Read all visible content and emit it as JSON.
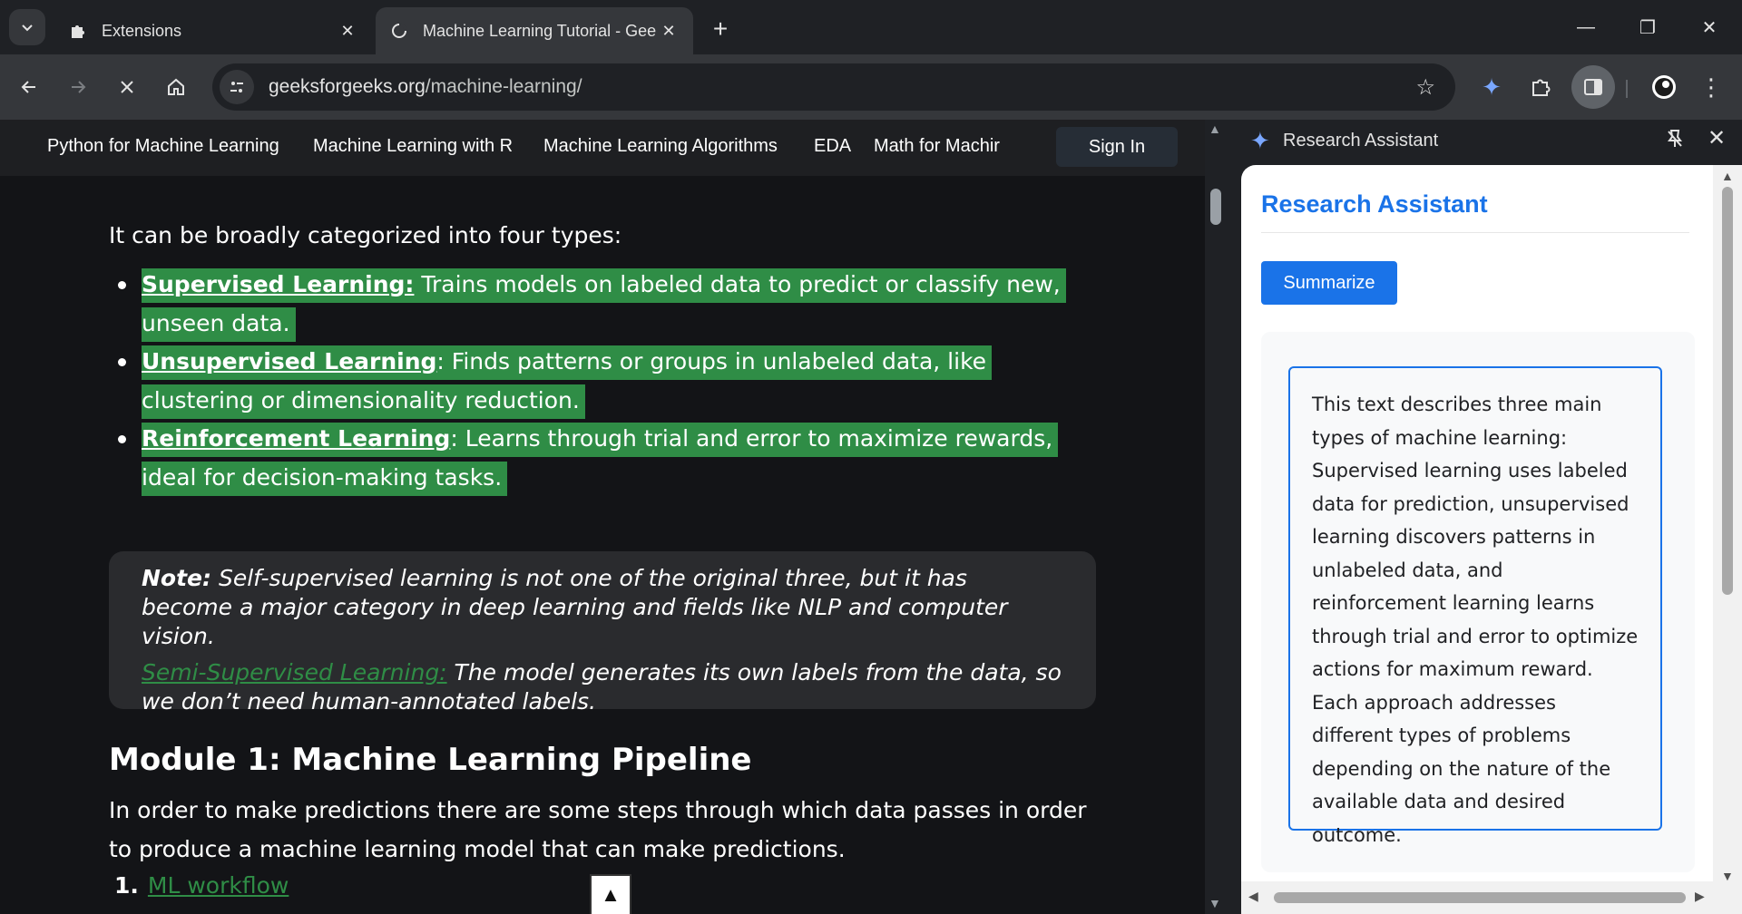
{
  "tabs": [
    {
      "title": "Extensions",
      "icon": "puzzle-icon"
    },
    {
      "title": "Machine Learning Tutorial - Gee",
      "icon": "loading-globe-icon",
      "active": true
    }
  ],
  "window": {
    "minimize": "—",
    "restore": "❐",
    "close": "✕"
  },
  "toolbar": {
    "url_domain": "geeksforgeeks.org",
    "url_path": "/machine-learning/"
  },
  "site": {
    "nav": [
      "Python for Machine Learning",
      "Machine Learning with R",
      "Machine Learning Algorithms",
      "EDA",
      "Math for Machir"
    ],
    "signin": "Sign In"
  },
  "article": {
    "intro": "It can be broadly categorized into four types:",
    "bullets": [
      {
        "term": "Supervised Learning:",
        "text": " Trains models on labeled data to predict or classify new, unseen data."
      },
      {
        "term": "Unsupervised Learning",
        "text": ": Finds patterns or groups in unlabeled data, like clustering or dimensionality reduction."
      },
      {
        "term": "Reinforcement Learning",
        "text": ": Learns through trial and error to maximize rewards, ideal for decision-making tasks."
      }
    ],
    "note_label": "Note:",
    "note_text": " Self-supervised learning is not one of the original three, but it has become a major category in deep learning and fields like NLP and computer vision.",
    "semi_label": "Semi-Supervised Learning:",
    "semi_text": " The model generates its own labels from the data, so we don’t need human-annotated labels.",
    "module_heading": "Module 1: Machine Learning Pipeline",
    "module_text": "In order to make predictions there are some steps through which data passes in order to produce a machine learning model that can make predictions.",
    "list_num": "1.",
    "list_link": "ML workflow",
    "scroll_top": "▲"
  },
  "side_panel": {
    "header_title": "Research Assistant",
    "heading": "Research Assistant",
    "button": "Summarize",
    "summary": "This text describes three main types of machine learning: Supervised learning uses labeled data for prediction, unsupervised learning discovers patterns in unlabeled data, and reinforcement learning learns through trial and error to optimize actions for maximum reward. Each approach addresses different types of problems depending on the nature of the available data and desired outcome."
  },
  "colors": {
    "accent": "#1a73e8",
    "highlight": "#2f8d46",
    "page_bg": "#131417"
  }
}
